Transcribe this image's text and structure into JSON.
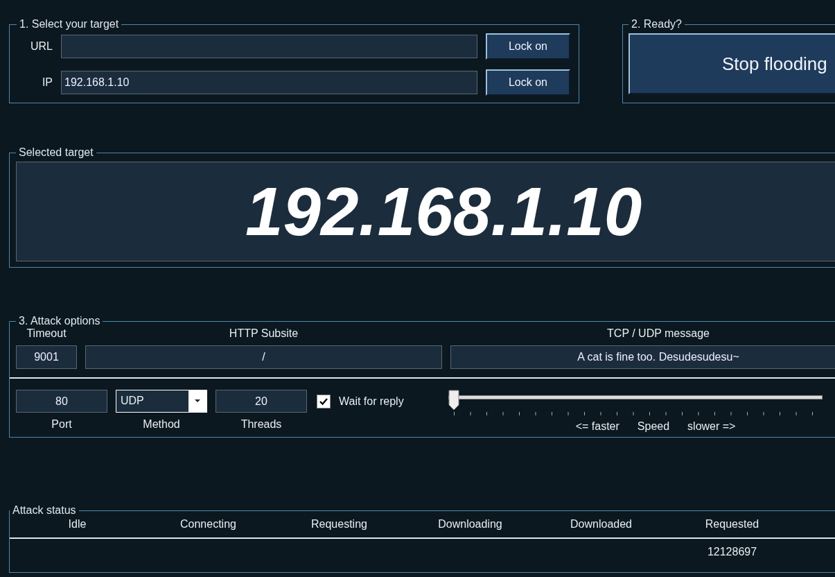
{
  "target_group": {
    "title": "1. Select your target",
    "rows": [
      {
        "label": "URL",
        "value": "",
        "button": "Lock on"
      },
      {
        "label": "IP",
        "value": "192.168.1.10",
        "button": "Lock on"
      }
    ]
  },
  "ready_group": {
    "title": "2. Ready?",
    "button": "Stop flooding"
  },
  "selected_target": {
    "title": "Selected target",
    "value": "192.168.1.10"
  },
  "attack_options": {
    "title": "3. Attack options",
    "timeout": {
      "label": "Timeout",
      "value": "9001"
    },
    "subsite": {
      "label": "HTTP Subsite",
      "value": "/"
    },
    "message": {
      "label": "TCP / UDP message",
      "value": "A cat is fine too. Desudesudesu~"
    },
    "port": {
      "label": "Port",
      "value": "80"
    },
    "method": {
      "label": "Method",
      "value": "UDP"
    },
    "threads": {
      "label": "Threads",
      "value": "20"
    },
    "wait_for_reply": {
      "label": "Wait for reply",
      "checked": true
    },
    "speed": {
      "label": "Speed",
      "left": "<= faster",
      "right": "slower =>",
      "level": 0
    }
  },
  "attack_status": {
    "title": "Attack status",
    "columns": [
      {
        "label": "Idle"
      },
      {
        "label": "Connecting"
      },
      {
        "label": "Requesting"
      },
      {
        "label": "Downloading"
      },
      {
        "label": "Downloaded"
      },
      {
        "label": "Requested",
        "value": "12128697"
      }
    ]
  }
}
